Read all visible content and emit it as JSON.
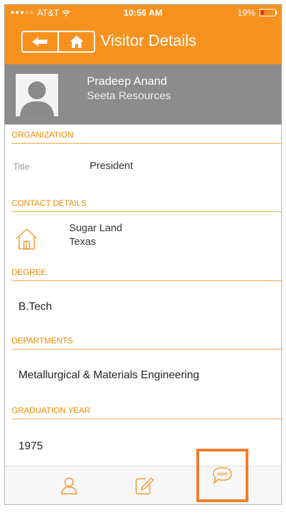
{
  "status_bar": {
    "carrier": "AT&T",
    "time": "10:56 AM",
    "battery_text": "19%"
  },
  "nav": {
    "title": "Visitor Details"
  },
  "profile": {
    "name": "Pradeep Anand",
    "organization": "Seeta Resources"
  },
  "organization": {
    "header": "ORGANIZATION",
    "title_label": "Title",
    "title_value": "President"
  },
  "contact": {
    "header": "CONTACT DETAILS",
    "city": "Sugar Land",
    "state": "Texas"
  },
  "degree": {
    "header": "DEGREE",
    "value": "B.Tech"
  },
  "departments": {
    "header": "DEPARTMENTS",
    "value": "Metallurgical & Materials Engineering"
  },
  "graduation": {
    "header": "GRADUATION YEAR",
    "value": "1975"
  },
  "tabbar": {
    "items": [
      "profile-icon",
      "edit-note-icon",
      "chat-bubble-icon"
    ],
    "highlighted_item": "chat-bubble-icon"
  },
  "colors": {
    "accent": "#f7921e",
    "profile_band": "#8c8c8c",
    "highlight_box": "#f27c27"
  }
}
